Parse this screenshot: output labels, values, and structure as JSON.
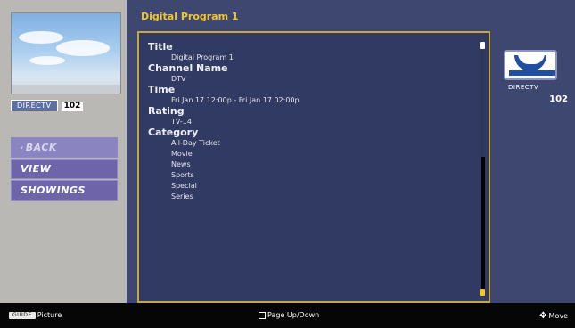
{
  "preview": {
    "channel_label": "DIRECTV",
    "channel_number": "102"
  },
  "menu": {
    "items": [
      {
        "label": "BACK"
      },
      {
        "label": "VIEW"
      },
      {
        "label": "SHOWINGS"
      }
    ]
  },
  "program": {
    "title": "Digital Program 1",
    "sections": [
      {
        "label": "Title",
        "values": [
          "Digital Program 1"
        ]
      },
      {
        "label": "Channel Name",
        "values": [
          "DTV"
        ]
      },
      {
        "label": "Time",
        "values": [
          "Fri Jan 17 12:00p - Fri Jan 17 02:00p"
        ]
      },
      {
        "label": "Rating",
        "values": [
          "TV-14"
        ]
      },
      {
        "label": "Category",
        "values": [
          "All-Day Ticket",
          "Movie",
          "News",
          "Sports",
          "Special",
          "Series"
        ]
      }
    ],
    "scroll_position": 0.45
  },
  "right_panel": {
    "channel_label": "DIRECTV",
    "channel_number": "102"
  },
  "footer": {
    "left_key": "GUIDE",
    "left_label": "Picture",
    "center_label": "Page Up/Down",
    "right_label": "Move"
  },
  "colors": {
    "panel": "#3d4770",
    "info_box": "#313a63",
    "accent_gold": "#f1c430",
    "menu_purple": "#6d64aa"
  }
}
